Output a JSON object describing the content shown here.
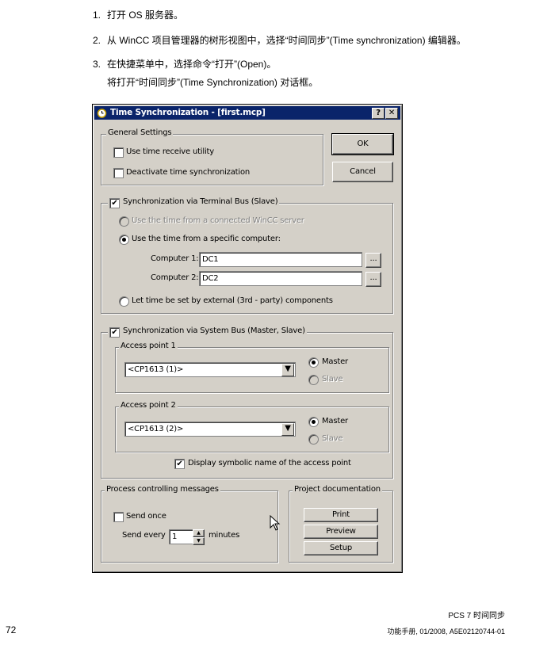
{
  "steps": [
    {
      "num": "1.",
      "text": "打开 OS 服务器。"
    },
    {
      "num": "2.",
      "text": "从 WinCC 项目管理器的树形视图中，选择“时间同步”(Time synchronization) 编辑器。"
    },
    {
      "num": "3.",
      "text": "在快捷菜单中，选择命令“打开”(Open)。"
    }
  ],
  "step3_note": "将打开“时间同步”(Time Synchronization) 对话框。",
  "dialog": {
    "title": "Time Synchronization - [first.mcp]",
    "help_btn": "?",
    "close_btn": "✕",
    "general": {
      "legend": "General Settings",
      "use_receive": "Use time receive utility",
      "deactivate": "Deactivate time synchronization"
    },
    "ok": "OK",
    "cancel": "Cancel",
    "terminal": {
      "legend": "Synchronization via Terminal Bus (Slave)",
      "checked": "✔",
      "opt_wincc": "Use the time from a connected WinCC server",
      "opt_specific": "Use the time from a specific computer:",
      "comp1_label": "Computer 1:",
      "comp1_value": "DC1",
      "comp2_label": "Computer 2:",
      "comp2_value": "DC2",
      "browse": "...",
      "opt_external": "Let time be set by external (3rd - party) components"
    },
    "system": {
      "legend": "Synchronization via System Bus (Master, Slave)",
      "checked": "✔",
      "ap1": {
        "legend": "Access point 1",
        "value": "<CP1613 (1)>",
        "master": "Master",
        "slave": "Slave"
      },
      "ap2": {
        "legend": "Access point 2",
        "value": "<CP1613 (2)>",
        "master": "Master",
        "slave": "Slave"
      },
      "display_symbolic": "Display symbolic name of the access point",
      "display_checked": "✔"
    },
    "process": {
      "legend": "Process controlling messages",
      "send_once": "Send once",
      "send_every": "Send every",
      "every_value": "1",
      "minutes": "minutes"
    },
    "project": {
      "legend": "Project documentation",
      "print": "Print",
      "preview": "Preview",
      "setup": "Setup"
    }
  },
  "footer": {
    "line1": "PCS 7 时间同步",
    "line2": "功能手册, 01/2008, A5E02120744-01",
    "page": "72"
  },
  "icons": {
    "combo": "dropdown-arrow-icon",
    "cursor": "mouse-pointer-icon",
    "app": "clock-icon"
  }
}
